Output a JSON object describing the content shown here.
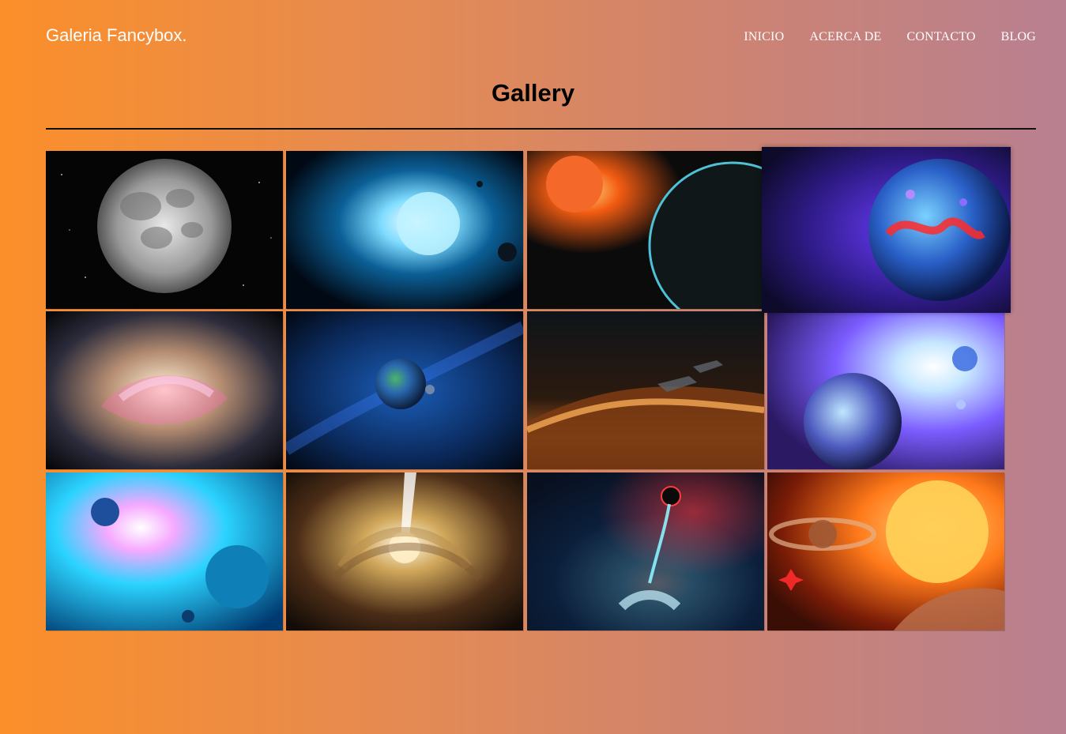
{
  "header": {
    "logo": "Galeria Fancybox.",
    "nav": [
      "INICIO",
      "ACERCA DE",
      "CONTACTO",
      "BLOG"
    ]
  },
  "page": {
    "title": "Gallery"
  },
  "gallery": {
    "images": [
      "moon-image",
      "blue-star-image",
      "fire-sun-planet-image",
      "purple-planet-image",
      "galaxy-nebula-image",
      "earth-space-image",
      "spaceships-planet-image",
      "bright-nebula-image",
      "blue-space-planets-image",
      "vortex-image",
      "blue-galaxy-image",
      "sun-saturn-image"
    ]
  },
  "colors": {
    "text": "#ffffff",
    "accent_orange": "#fb8f2a",
    "accent_mauve": "#b88091"
  }
}
